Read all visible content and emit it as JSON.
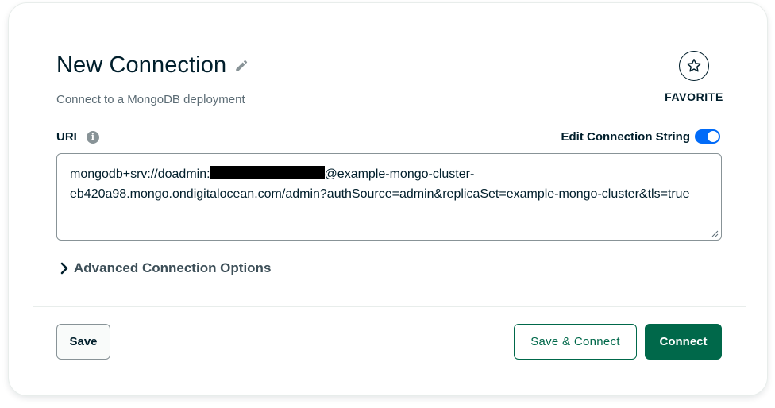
{
  "header": {
    "title": "New Connection",
    "subtitle": "Connect to a MongoDB deployment",
    "edit_icon": "pencil-icon"
  },
  "favorite": {
    "label": "FAVORITE",
    "icon": "star-icon"
  },
  "uri": {
    "label": "URI",
    "info_icon": "info-icon",
    "info_glyph": "i",
    "edit_toggle_label": "Edit Connection String",
    "edit_toggle_on": true,
    "value_prefix": "mongodb+srv://doadmin:",
    "value_suffix": "@example-mongo-cluster-eb420a98.mongo.ondigitalocean.com/admin?authSource=admin&replicaSet=example-mongo-cluster&tls=true"
  },
  "advanced": {
    "label": "Advanced Connection Options",
    "icon": "chevron-right-icon"
  },
  "footer": {
    "save_label": "Save",
    "save_connect_label": "Save & Connect",
    "connect_label": "Connect"
  },
  "colors": {
    "accent_green": "#00684a",
    "toggle_blue": "#016bf8",
    "text_dark": "#001e2b"
  }
}
